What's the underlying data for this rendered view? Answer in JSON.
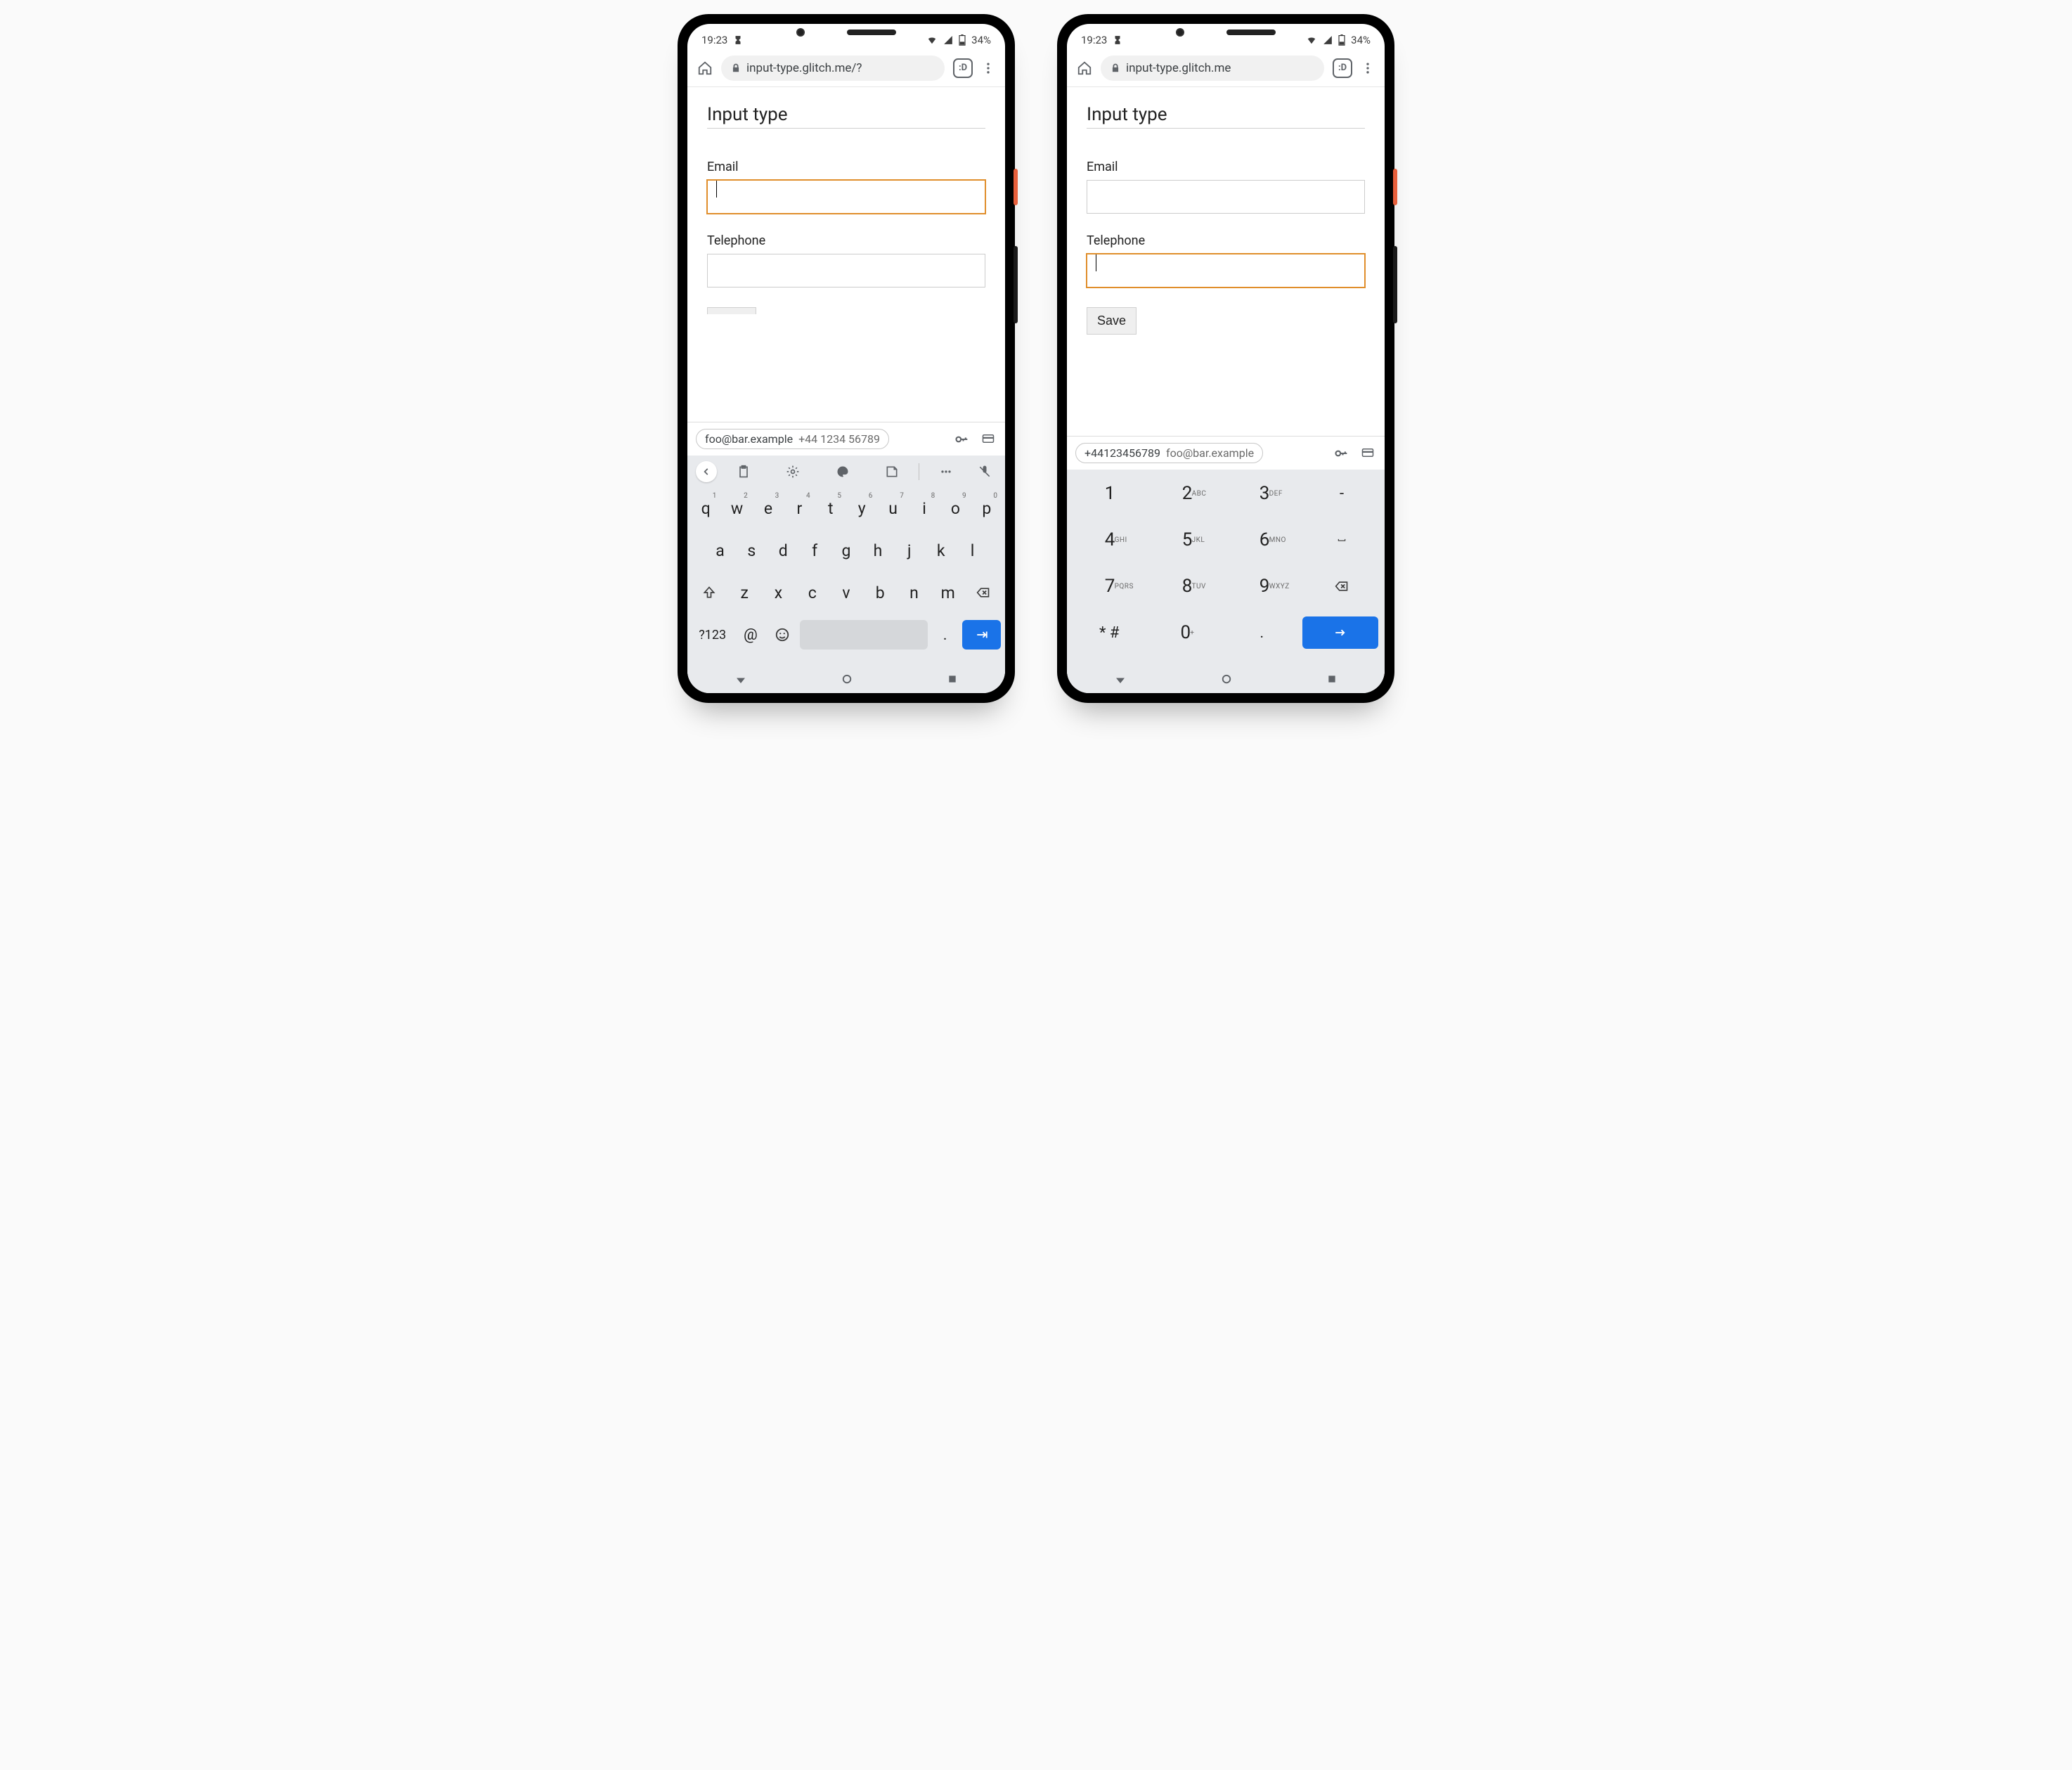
{
  "status": {
    "time": "19:23",
    "battery": "34%"
  },
  "browser": {
    "url_left": "input-type.glitch.me/?",
    "url_right": "input-type.glitch.me",
    "tab_label": ":D"
  },
  "page": {
    "title": "Input type",
    "email_label": "Email",
    "tel_label": "Telephone",
    "save_label": "Save"
  },
  "autofill": {
    "email_first": "foo@bar.example",
    "phone_first": "+44 1234 56789",
    "phone_compact": "+44123456789"
  },
  "qwerty": {
    "row1": [
      {
        "k": "q",
        "n": "1"
      },
      {
        "k": "w",
        "n": "2"
      },
      {
        "k": "e",
        "n": "3"
      },
      {
        "k": "r",
        "n": "4"
      },
      {
        "k": "t",
        "n": "5"
      },
      {
        "k": "y",
        "n": "6"
      },
      {
        "k": "u",
        "n": "7"
      },
      {
        "k": "i",
        "n": "8"
      },
      {
        "k": "o",
        "n": "9"
      },
      {
        "k": "p",
        "n": "0"
      }
    ],
    "row2": [
      "a",
      "s",
      "d",
      "f",
      "g",
      "h",
      "j",
      "k",
      "l"
    ],
    "row3": [
      "z",
      "x",
      "c",
      "v",
      "b",
      "n",
      "m"
    ],
    "sym": "?123",
    "at": "@",
    "period": "."
  },
  "numpad": {
    "rows": [
      [
        {
          "k": "1",
          "l": ""
        },
        {
          "k": "2",
          "l": "ABC"
        },
        {
          "k": "3",
          "l": "DEF"
        },
        {
          "k": "-",
          "l": ""
        }
      ],
      [
        {
          "k": "4",
          "l": "GHI"
        },
        {
          "k": "5",
          "l": "JKL"
        },
        {
          "k": "6",
          "l": "MNO"
        },
        {
          "k": "␣",
          "l": ""
        }
      ],
      [
        {
          "k": "7",
          "l": "PQRS"
        },
        {
          "k": "8",
          "l": "TUV"
        },
        {
          "k": "9",
          "l": "WXYZ"
        },
        {
          "k": "⌫",
          "l": ""
        }
      ],
      [
        {
          "k": "* #",
          "l": ""
        },
        {
          "k": "0",
          "l": "+"
        },
        {
          "k": ".",
          "l": ""
        },
        {
          "k": "ENTER",
          "l": ""
        }
      ]
    ]
  }
}
